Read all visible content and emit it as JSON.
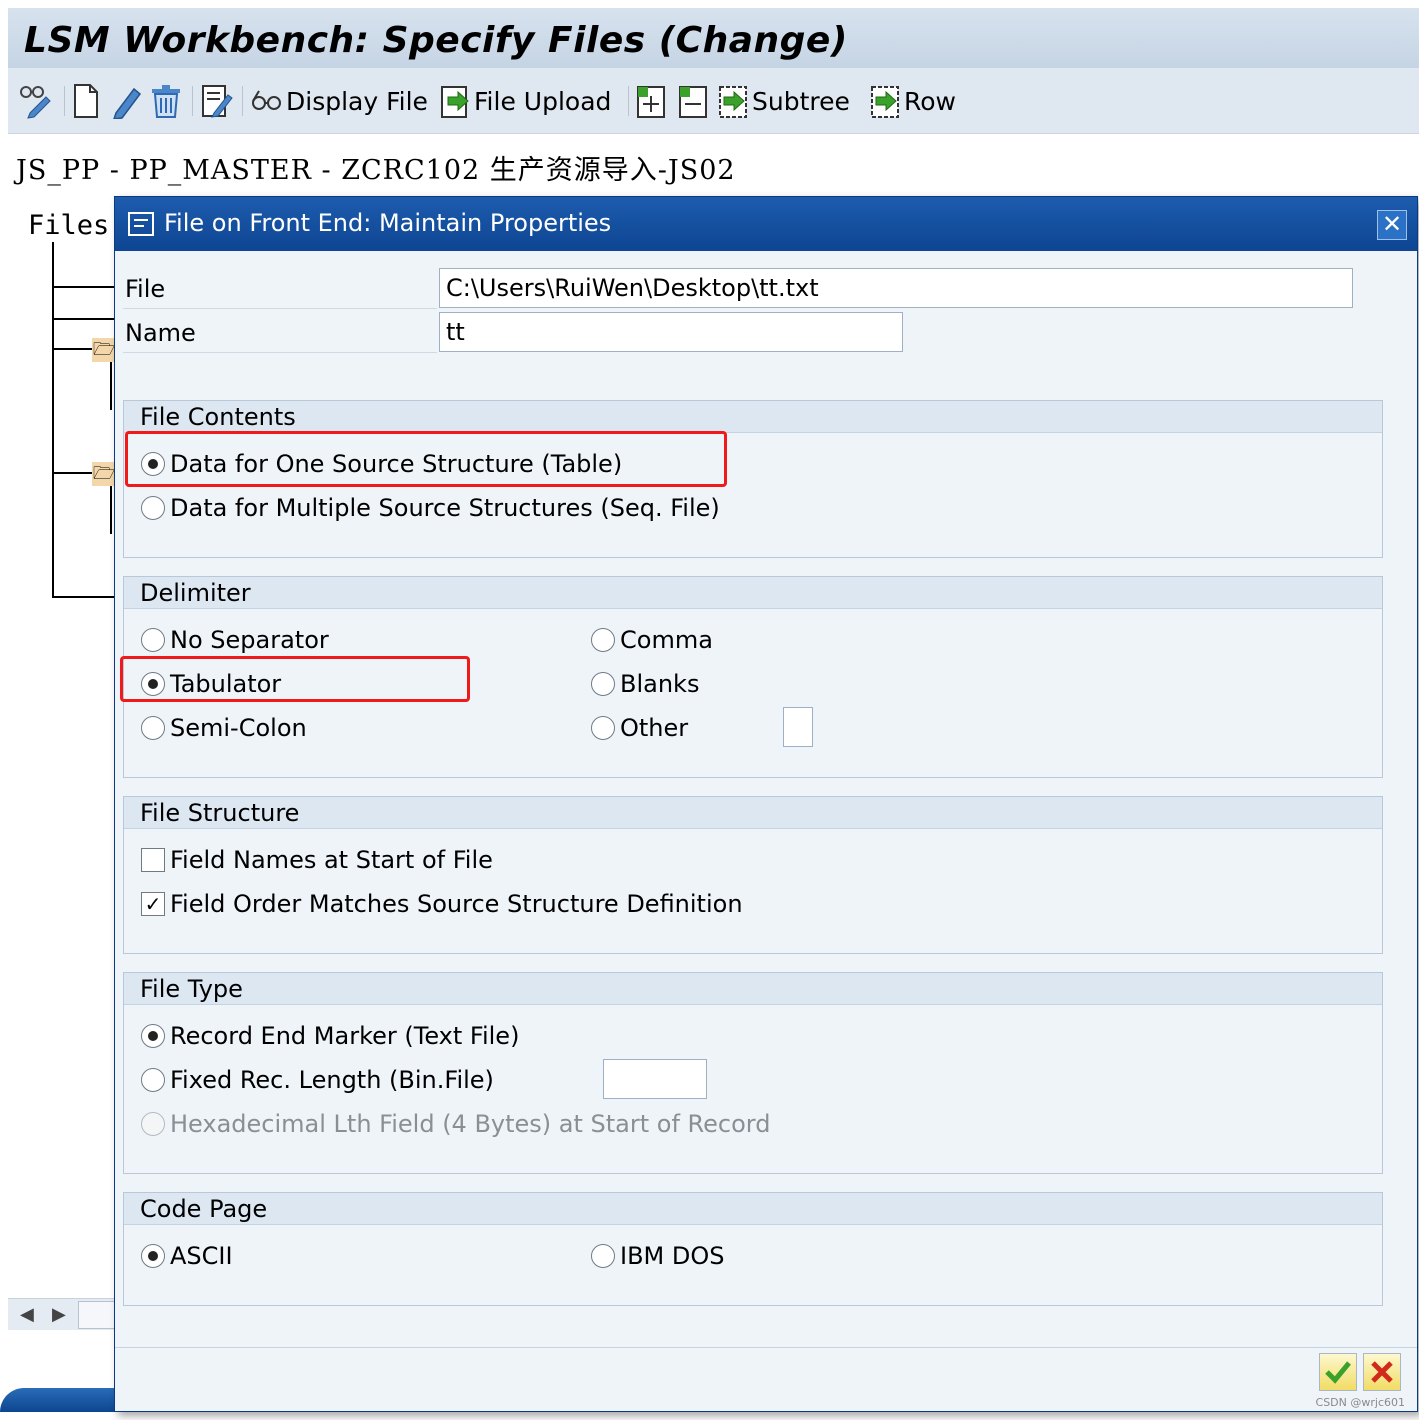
{
  "window": {
    "title": "LSM Workbench: Specify Files (Change)",
    "object_path": "JS_PP - PP_MASTER - ZCRC102 生产资源导入-JS02",
    "tree_root_label": "Files"
  },
  "toolbar": {
    "display_file": "Display File",
    "file_upload": "File Upload",
    "subtree": "Subtree",
    "row": "Row"
  },
  "dialog": {
    "title": "File on Front End: Maintain Properties",
    "file_label": "File",
    "file_value": "C:\\Users\\RuiWen\\Desktop\\tt.txt",
    "name_label": "Name",
    "name_value": "tt",
    "file_contents": {
      "header": "File Contents",
      "opt_one": "Data for One Source Structure (Table)",
      "opt_multi": "Data for Multiple Source Structures (Seq. File)",
      "selected": "opt_one"
    },
    "delimiter": {
      "header": "Delimiter",
      "no_separator": "No Separator",
      "tabulator": "Tabulator",
      "semi_colon": "Semi-Colon",
      "comma": "Comma",
      "blanks": "Blanks",
      "other": "Other",
      "other_value": "",
      "selected": "tabulator"
    },
    "file_structure": {
      "header": "File Structure",
      "field_names": "Field Names at Start of File",
      "field_names_checked": false,
      "field_order": "Field Order Matches Source Structure Definition",
      "field_order_checked": true
    },
    "file_type": {
      "header": "File Type",
      "record_end": "Record End Marker (Text File)",
      "fixed_len": "Fixed Rec. Length (Bin.File)",
      "fixed_len_value": "",
      "hex_len": "Hexadecimal Lth Field (4 Bytes) at Start of Record",
      "selected": "record_end"
    },
    "code_page": {
      "header": "Code Page",
      "ascii": "ASCII",
      "ibm_dos": "IBM DOS",
      "selected": "ascii"
    }
  },
  "watermark": "CSDN @wrjc601",
  "colors": {
    "dialog_title_bg": "#0d4592",
    "highlight": "#f01a1a",
    "confirm": "#3aa12a",
    "cancel": "#d22a1a"
  },
  "icons": [
    "glasses-edit-icon",
    "new-document-icon",
    "pencil-icon",
    "trash-icon",
    "edit-list-icon",
    "glasses-icon",
    "upload-icon",
    "insert-icon",
    "collapse-icon",
    "subtree-icon",
    "row-icon",
    "checkmark-icon",
    "cancel-icon",
    "folder-icon"
  ]
}
